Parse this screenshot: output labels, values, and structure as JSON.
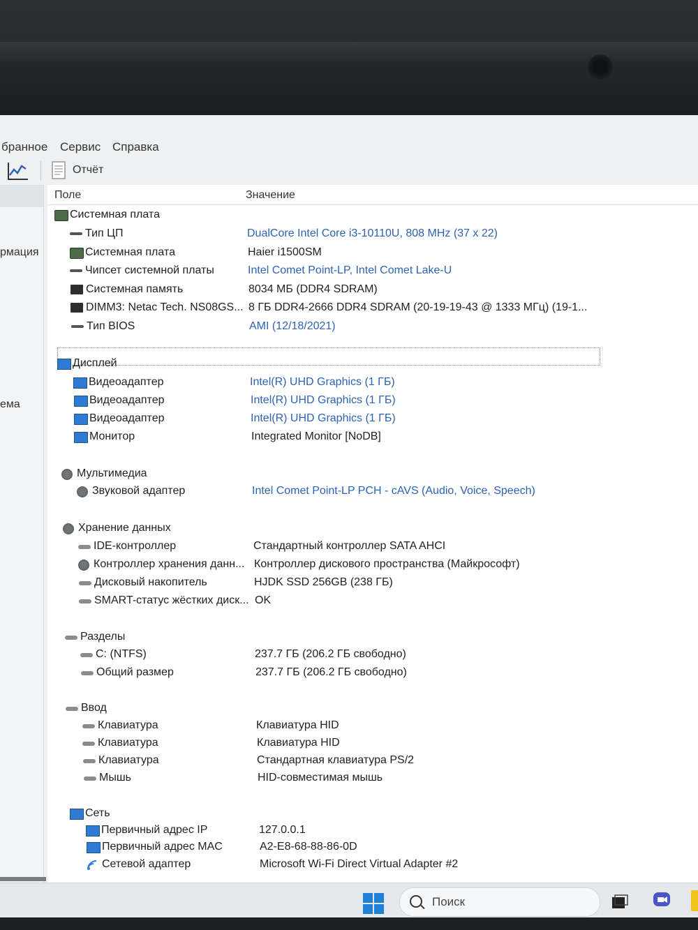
{
  "menu": [
    "бранное",
    "Сервис",
    "Справка"
  ],
  "toolbar": {
    "report_label": "Отчёт"
  },
  "left_panel": {
    "items": [
      "рмация",
      "ема"
    ]
  },
  "columns": {
    "field": "Поле",
    "value": "Значение"
  },
  "sections": [
    {
      "title": "Системная плата",
      "rows": [
        {
          "field": "Тип ЦП",
          "value": "DualCore Intel Core i3-10110U, 808 MHz (37 x 22)",
          "link": true
        },
        {
          "field": "Системная плата",
          "value": "Haier i1500SM",
          "link": false
        },
        {
          "field": "Чипсет системной платы",
          "value": "Intel Comet Point-LP, Intel Comet Lake-U",
          "link": true
        },
        {
          "field": "Системная память",
          "value": "8034 МБ  (DDR4 SDRAM)",
          "link": false
        },
        {
          "field": "DIMM3: Netac Tech. NS08GS...",
          "value": "8 ГБ DDR4-2666 DDR4 SDRAM  (20-19-19-43 @ 1333 МГц)  (19-1...",
          "link": false
        },
        {
          "field": "Тип BIOS",
          "value": "AMI (12/18/2021)",
          "link": true
        }
      ]
    },
    {
      "title": "Дисплей",
      "rows": [
        {
          "field": "Видеоадаптер",
          "value": "Intel(R) UHD Graphics  (1 ГБ)",
          "link": true
        },
        {
          "field": "Видеоадаптер",
          "value": "Intel(R) UHD Graphics  (1 ГБ)",
          "link": true
        },
        {
          "field": "Видеоадаптер",
          "value": "Intel(R) UHD Graphics  (1 ГБ)",
          "link": true
        },
        {
          "field": "Монитор",
          "value": "Integrated Monitor [NoDB]",
          "link": false
        }
      ]
    },
    {
      "title": "Мультимедиа",
      "rows": [
        {
          "field": "Звуковой адаптер",
          "value": "Intel Comet Point-LP PCH - cAVS (Audio, Voice, Speech)",
          "link": true
        }
      ]
    },
    {
      "title": "Хранение данных",
      "rows": [
        {
          "field": "IDE-контроллер",
          "value": "Стандартный контроллер SATA AHCI",
          "link": false
        },
        {
          "field": "Контроллер хранения данн...",
          "value": "Контроллер дискового пространства (Майкрософт)",
          "link": false
        },
        {
          "field": "Дисковый накопитель",
          "value": "HJDK SSD 256GB  (238 ГБ)",
          "link": false
        },
        {
          "field": "SMART-статус жёстких диск...",
          "value": "OK",
          "link": false
        }
      ]
    },
    {
      "title": "Разделы",
      "rows": [
        {
          "field": "C: (NTFS)",
          "value": "237.7 ГБ (206.2 ГБ свободно)",
          "link": false
        },
        {
          "field": "Общий размер",
          "value": "237.7 ГБ (206.2 ГБ свободно)",
          "link": false
        }
      ]
    },
    {
      "title": "Ввод",
      "rows": [
        {
          "field": "Клавиатура",
          "value": "Клавиатура HID",
          "link": false
        },
        {
          "field": "Клавиатура",
          "value": "Клавиатура HID",
          "link": false
        },
        {
          "field": "Клавиатура",
          "value": "Стандартная клавиатура PS/2",
          "link": false
        },
        {
          "field": "Мышь",
          "value": "HID-совместимая мышь",
          "link": false
        }
      ]
    },
    {
      "title": "Сеть",
      "rows": [
        {
          "field": "Первичный адрес IP",
          "value": "127.0.0.1",
          "link": false
        },
        {
          "field": "Первичный адрес MAC",
          "value": "A2-E8-68-88-86-0D",
          "link": false
        },
        {
          "field": "Сетевой адаптер",
          "value": "Microsoft Wi-Fi Direct Virtual Adapter #2",
          "link": false
        }
      ]
    }
  ],
  "taskbar": {
    "search_placeholder": "Поиск"
  },
  "colors": {
    "link": "#2c63b5",
    "text": "#222222",
    "accent": "#1e7fd6"
  },
  "icons": [
    "chart-icon",
    "report-icon",
    "motherboard-icon",
    "cpu-icon",
    "memory-icon",
    "display-icon",
    "multimedia-icon",
    "storage-icon",
    "partition-icon",
    "keyboard-icon",
    "network-icon",
    "windows-logo-icon",
    "search-icon"
  ]
}
